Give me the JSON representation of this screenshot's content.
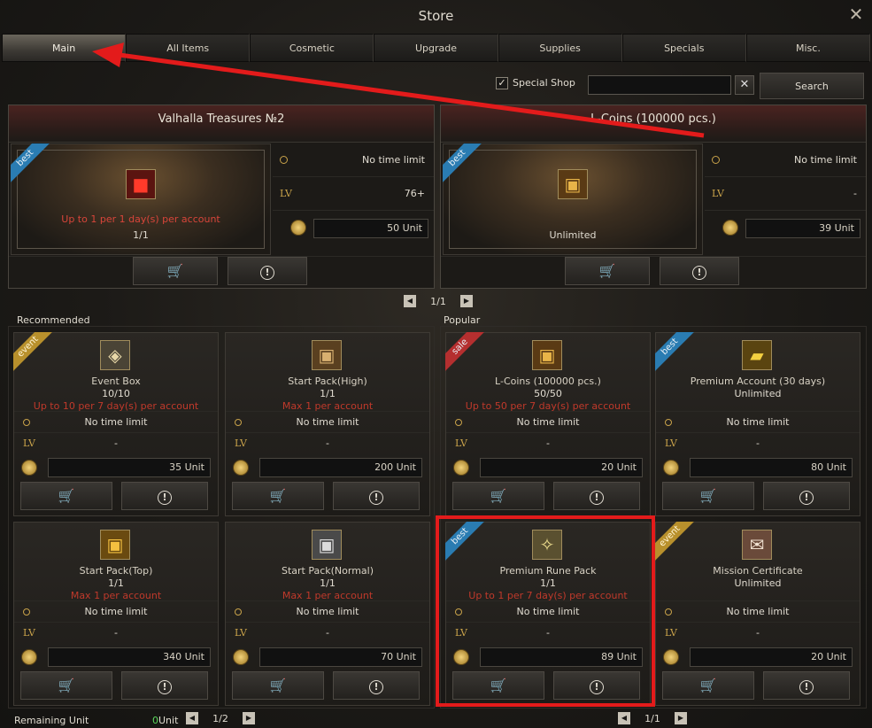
{
  "window": {
    "title": "Store",
    "close_icon": "close-icon"
  },
  "tabs": [
    {
      "label": "Main",
      "active": true
    },
    {
      "label": "All Items"
    },
    {
      "label": "Cosmetic"
    },
    {
      "label": "Upgrade"
    },
    {
      "label": "Supplies"
    },
    {
      "label": "Specials"
    },
    {
      "label": "Misc."
    }
  ],
  "toolbar": {
    "special_shop_label": "Special Shop",
    "special_shop_checked": true,
    "search_value": "",
    "clear_label": "✕",
    "search_label": "Search"
  },
  "featured": [
    {
      "title": "Valhalla Treasures №2",
      "ribbon": "best",
      "icon": "red-cube-icon",
      "limit": "Up to 1 per 1 day(s) per account",
      "qty": "1/1",
      "time": "No time limit",
      "lv_label": "LV",
      "lv": "76+",
      "price": "50 Unit"
    },
    {
      "title": "L-Coins (100000 pcs.)",
      "ribbon": "best",
      "icon": "treasure-chest-icon",
      "limit": "",
      "qty": "Unlimited",
      "time": "No time limit",
      "lv_label": "LV",
      "lv": "-",
      "price": "39 Unit"
    }
  ],
  "featured_pager": {
    "page": "1/1"
  },
  "recommended": {
    "label": "Recommended",
    "pager": "1/2",
    "items": [
      {
        "name": "Event Box",
        "qty": "10/10",
        "limit": "Up to 10 per 7 day(s) per account",
        "ribbon": "event",
        "icon": "event-box-icon",
        "time": "No time limit",
        "lv_label": "LV",
        "lv": "-",
        "price": "35 Unit"
      },
      {
        "name": "Start Pack(High)",
        "qty": "1/1",
        "limit": "Max 1 per account",
        "ribbon": "",
        "icon": "chest-icon",
        "time": "No time limit",
        "lv_label": "LV",
        "lv": "-",
        "price": "200 Unit"
      },
      {
        "name": "Start Pack(Top)",
        "qty": "1/1",
        "limit": "Max 1 per account",
        "ribbon": "",
        "icon": "gold-chest-icon",
        "time": "No time limit",
        "lv_label": "LV",
        "lv": "-",
        "price": "340 Unit"
      },
      {
        "name": "Start Pack(Normal)",
        "qty": "1/1",
        "limit": "Max 1 per account",
        "ribbon": "",
        "icon": "silver-chest-icon",
        "time": "No time limit",
        "lv_label": "LV",
        "lv": "-",
        "price": "70 Unit"
      }
    ]
  },
  "popular": {
    "label": "Popular",
    "pager": "1/1",
    "items": [
      {
        "name": "L-Coins (100000 pcs.)",
        "qty": "50/50",
        "limit": "Up to 50 per 7 day(s) per account",
        "ribbon": "sale",
        "icon": "treasure-chest-icon",
        "time": "No time limit",
        "lv_label": "LV",
        "lv": "-",
        "price": "20 Unit"
      },
      {
        "name": "Premium Account (30 days)",
        "qty": "Unlimited",
        "limit": "",
        "ribbon": "best",
        "icon": "gold-ticket-icon",
        "time": "No time limit",
        "lv_label": "LV",
        "lv": "-",
        "price": "80 Unit"
      },
      {
        "name": "Premium Rune Pack",
        "qty": "1/1",
        "limit": "Up to 1 per 7 day(s) per account",
        "ribbon": "best",
        "icon": "rune-feather-icon",
        "time": "No time limit",
        "lv_label": "LV",
        "lv": "-",
        "price": "89 Unit"
      },
      {
        "name": "Mission Certificate",
        "qty": "Unlimited",
        "limit": "",
        "ribbon": "event",
        "icon": "scroll-icon",
        "time": "No time limit",
        "lv_label": "LV",
        "lv": "-",
        "price": "20 Unit"
      }
    ]
  },
  "footer": {
    "remaining_label": "Remaining Unit",
    "remaining_value": "0",
    "unit": "Unit"
  },
  "colors": {
    "annotation_red": "#e31b1b",
    "limit_red": "#c0392b",
    "lv_gold": "#c9a34a"
  }
}
